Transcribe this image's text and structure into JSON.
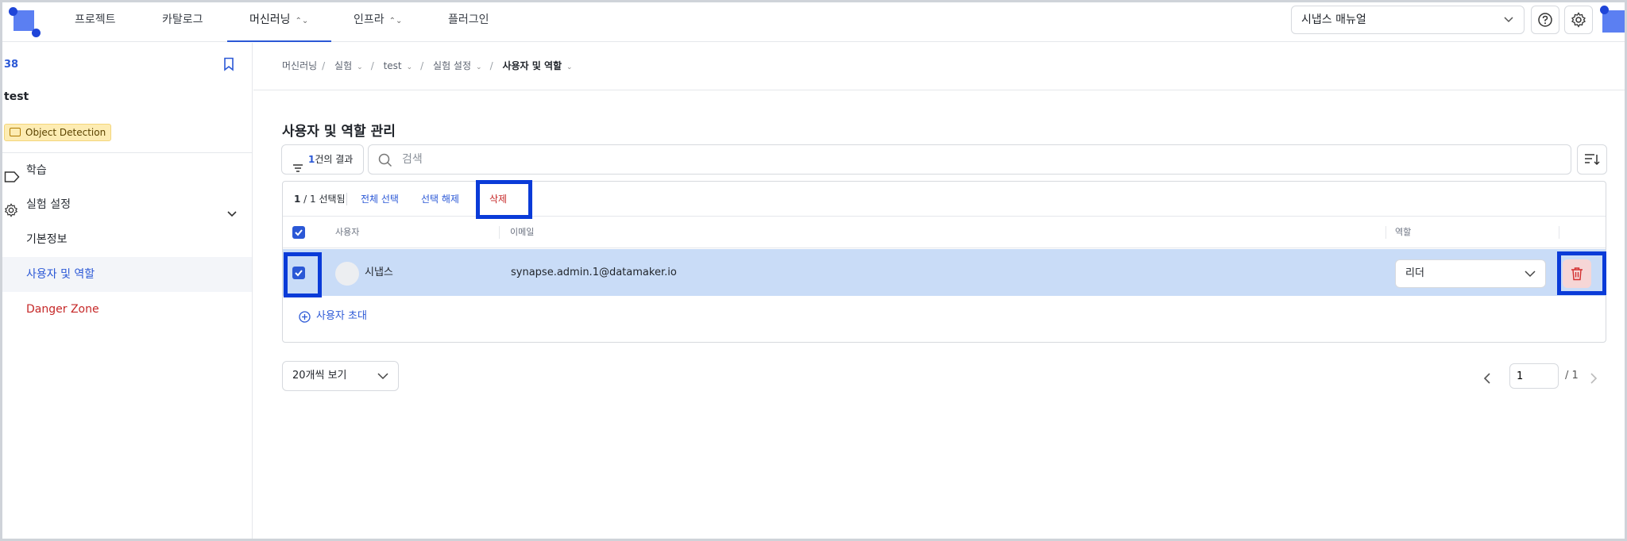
{
  "topnav": {
    "items": [
      {
        "label": "프로젝트"
      },
      {
        "label": "카탈로그"
      },
      {
        "label": "머신러닝"
      },
      {
        "label": "인프라"
      },
      {
        "label": "플러그인"
      }
    ],
    "manual_select": "시냅스 매뉴얼",
    "icons": [
      "logo",
      "chevron-down-icon",
      "help-icon",
      "gear-icon",
      "user-avatar"
    ]
  },
  "sidebar": {
    "experiment_id": "38",
    "experiment_name": "test",
    "badge": "Object Detection",
    "training_label": "학습",
    "settings_label": "실험 설정",
    "sub_items": [
      {
        "label": "기본정보"
      },
      {
        "label": "사용자 및 역할"
      },
      {
        "label": "Danger Zone"
      }
    ]
  },
  "breadcrumb": {
    "items": [
      "머신러닝",
      "실험",
      "test",
      "실험 설정",
      "사용자 및 역할"
    ]
  },
  "page": {
    "title": "사용자 및 역할 관리"
  },
  "toolbar": {
    "result_count": "1",
    "result_suffix": "건의 결과",
    "search_placeholder": "검색"
  },
  "selection": {
    "count": "1",
    "count_rest": " / 1 선택됨",
    "select_all": "전체 선택",
    "deselect": "선택 해제",
    "delete": "삭제"
  },
  "table": {
    "columns": [
      "사용자",
      "이메일",
      "역할"
    ],
    "rows": [
      {
        "user": "시냅스",
        "email": "synapse.admin.1@datamaker.io",
        "role": "리더",
        "selected": true
      }
    ]
  },
  "invite_label": "사용자 초대",
  "pagination": {
    "per_page": "20개씩 보기",
    "current_page": "1",
    "total": "/ 1"
  },
  "colors": {
    "accent": "#2b58d6",
    "selected_row": "#c9dcf7",
    "danger": "#c62828",
    "highlight": "#0a3bd8"
  }
}
